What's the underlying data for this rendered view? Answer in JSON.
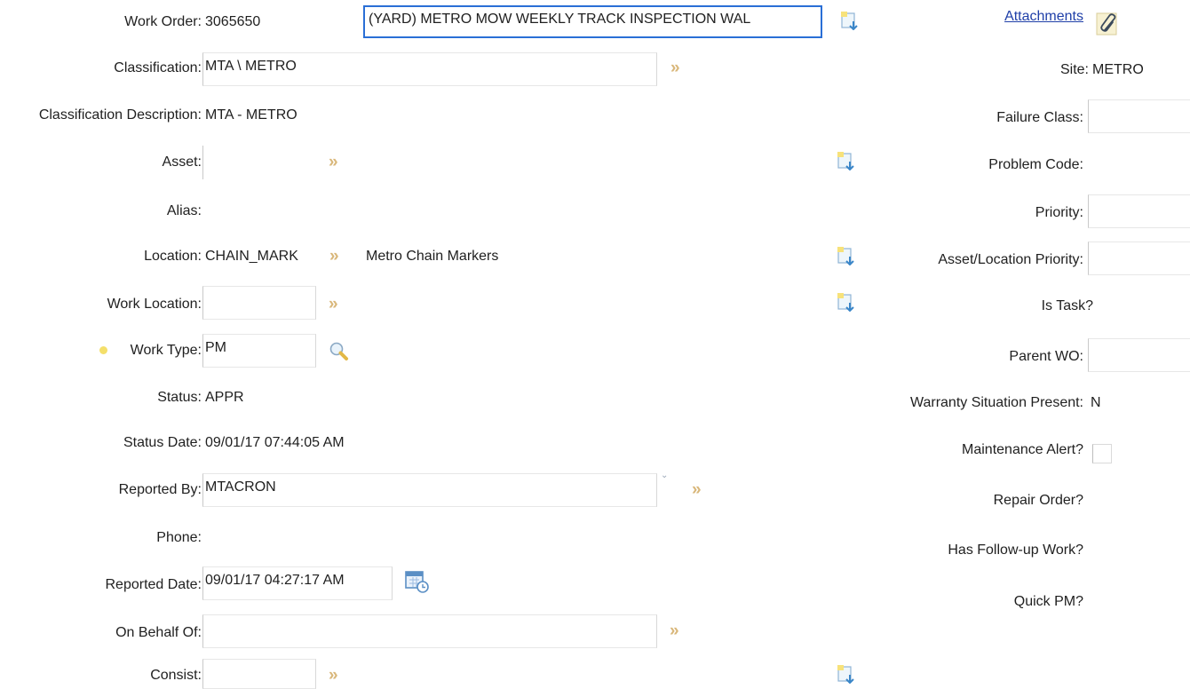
{
  "left": {
    "work_order_label": "Work Order:",
    "work_order_value": "3065650",
    "description_value": "(YARD) METRO MOW WEEKLY TRACK INSPECTION WAL",
    "classification_label": "Classification:",
    "classification_value": "MTA \\ METRO",
    "classification_desc_label": "Classification Description:",
    "classification_desc_value": "MTA - METRO",
    "asset_label": "Asset:",
    "asset_value": "",
    "alias_label": "Alias:",
    "location_label": "Location:",
    "location_value": "CHAIN_MARK",
    "location_desc": "Metro Chain Markers",
    "work_location_label": "Work Location:",
    "work_location_value": "",
    "work_type_label": "Work Type:",
    "work_type_value": "PM",
    "status_label": "Status:",
    "status_value": "APPR",
    "status_date_label": "Status Date:",
    "status_date_value": "09/01/17 07:44:05 AM",
    "reported_by_label": "Reported By:",
    "reported_by_value": "MTACRON",
    "phone_label": "Phone:",
    "reported_date_label": "Reported Date:",
    "reported_date_value": "09/01/17 04:27:17 AM",
    "on_behalf_label": "On Behalf Of:",
    "on_behalf_value": "",
    "consist_label": "Consist:",
    "consist_value": ""
  },
  "right": {
    "attachments_link": "Attachments",
    "site_label": "Site:",
    "site_value": "METRO",
    "failure_class_label": "Failure Class:",
    "problem_code_label": "Problem Code:",
    "priority_label": "Priority:",
    "asset_location_priority_label": "Asset/Location Priority:",
    "is_task_label": "Is Task?",
    "parent_wo_label": "Parent WO:",
    "warranty_label": "Warranty Situation Present:",
    "warranty_value": "N",
    "maintenance_alert_label": "Maintenance Alert?",
    "repair_order_label": "Repair Order?",
    "follow_up_label": "Has Follow-up Work?",
    "quick_pm_label": "Quick PM?"
  },
  "icons": {
    "chevron": "double-chevron-right-icon",
    "detail_menu": "detail-menu-icon",
    "search": "magnifier-icon",
    "calendar": "calendar-icon",
    "attachments": "paperclip-icon",
    "chevron_glyph": "»"
  },
  "colors": {
    "accent_border": "#2a6fd6",
    "chevron": "#d9b77a",
    "required_dot": "#f4df6a",
    "link": "#1f3fa8"
  }
}
